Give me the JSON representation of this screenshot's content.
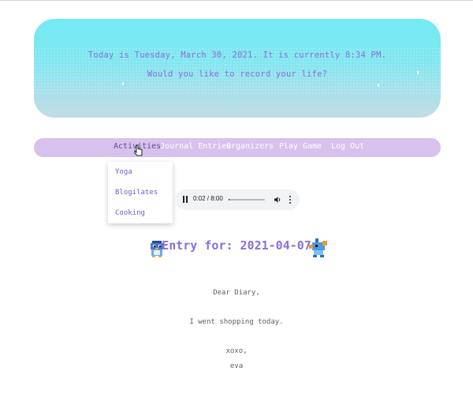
{
  "banner": {
    "date_line": "Today is Tuesday, March 30, 2021. It is currently 8:34 PM.",
    "prompt_line": "Would you like to record your life?"
  },
  "nav": {
    "items": [
      {
        "label": "Activities"
      },
      {
        "label": "Journal Entries"
      },
      {
        "label": "Organizers"
      },
      {
        "label": "Play Game"
      },
      {
        "label": "Log Out"
      }
    ],
    "dropdown": [
      "Yoga",
      "Blogilates",
      "Cooking"
    ]
  },
  "player": {
    "time": "0:02 / 8:00",
    "progress_fraction": 0.02
  },
  "entry": {
    "title": "Entry for: 2021-04-07",
    "lines": [
      "Dear Diary,",
      "I went shopping today.",
      "xoxo,",
      "eva"
    ]
  },
  "colors": {
    "accent": "#8a6fd8",
    "nav_bg": "#d6c2ec",
    "banner_top": "#72eaf4",
    "banner_bottom": "#c2dde4"
  },
  "icons": [
    "pause-icon",
    "volume-icon",
    "more-options-icon",
    "penguin-sprite-icon",
    "fish-sprite-icon",
    "cursor-icon"
  ]
}
